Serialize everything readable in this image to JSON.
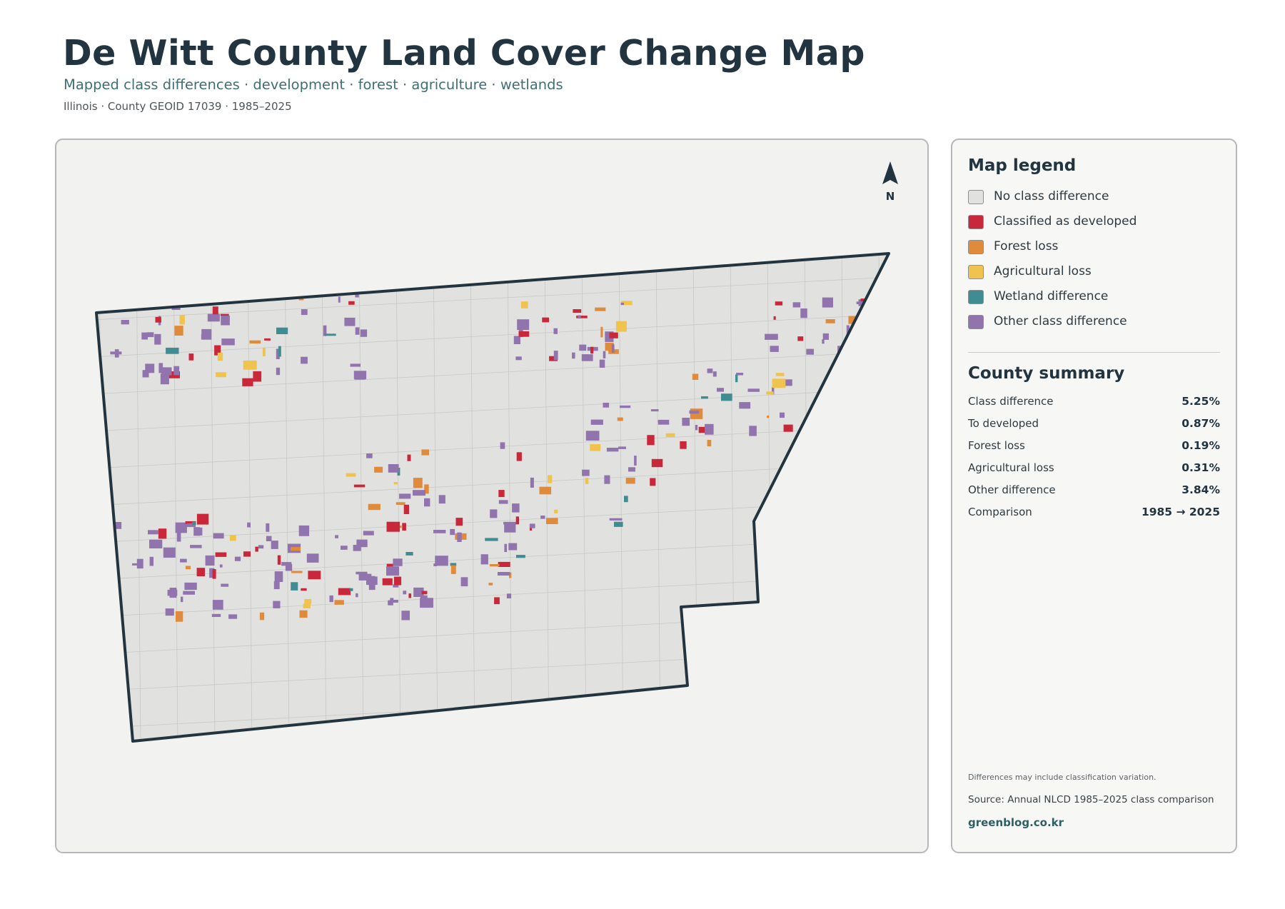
{
  "header": {
    "title": "De Witt County Land Cover Change Map",
    "subtitle": "Mapped class differences · development · forest · agriculture · wetlands",
    "meta": "Illinois · County GEOID 17039 · 1985–2025"
  },
  "map": {
    "north_label": "N",
    "county_fill": "#e1e2df",
    "county_outline": "#22343f",
    "grid_color": "#c7c9c6"
  },
  "legend": {
    "heading": "Map legend",
    "items": [
      {
        "label": "No class difference",
        "color": "#e1e1df"
      },
      {
        "label": "Classified as developed",
        "color": "#c9283a"
      },
      {
        "label": "Forest loss",
        "color": "#e08a3c"
      },
      {
        "label": "Agricultural loss",
        "color": "#f0c24e"
      },
      {
        "label": "Wetland difference",
        "color": "#3f8c92"
      },
      {
        "label": "Other class difference",
        "color": "#9173ad"
      }
    ]
  },
  "summary": {
    "heading": "County summary",
    "rows": [
      {
        "label": "Class difference",
        "value": "5.25%"
      },
      {
        "label": "To developed",
        "value": "0.87%"
      },
      {
        "label": "Forest loss",
        "value": "0.19%"
      },
      {
        "label": "Agricultural loss",
        "value": "0.31%"
      },
      {
        "label": "Other difference",
        "value": "3.84%"
      },
      {
        "label": "Comparison",
        "value": "1985 → 2025"
      }
    ]
  },
  "footer": {
    "note": "Differences may include classification variation.",
    "source": "Source: Annual NLCD 1985–2025 class comparison",
    "credit": "greenblog.co.kr"
  }
}
